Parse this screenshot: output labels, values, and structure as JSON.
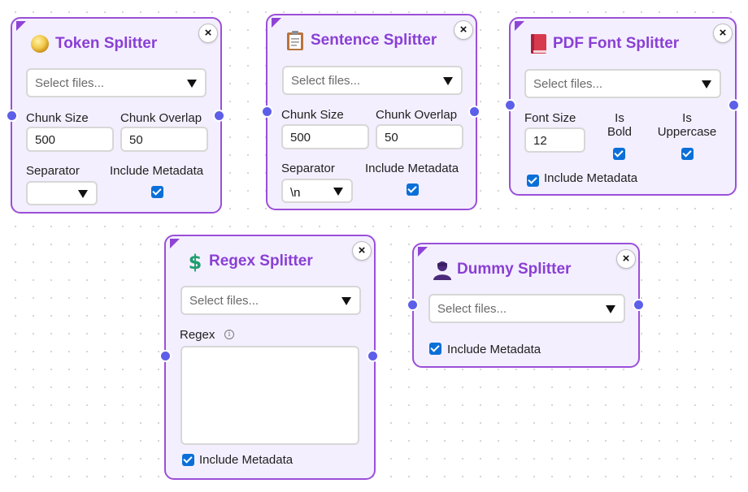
{
  "nodes": {
    "token": {
      "title": "Token Splitter",
      "icon": "coin-icon",
      "file_select_placeholder": "Select files...",
      "chunk_size_label": "Chunk Size",
      "chunk_size_value": "500",
      "chunk_overlap_label": "Chunk Overlap",
      "chunk_overlap_value": "50",
      "separator_label": "Separator",
      "separator_value": "",
      "include_metadata_label": "Include Metadata",
      "include_metadata_checked": true
    },
    "sentence": {
      "title": "Sentence Splitter",
      "icon": "clipboard-icon",
      "file_select_placeholder": "Select files...",
      "chunk_size_label": "Chunk Size",
      "chunk_size_value": "500",
      "chunk_overlap_label": "Chunk Overlap",
      "chunk_overlap_value": "50",
      "separator_label": "Separator",
      "separator_value": "\\n",
      "include_metadata_label": "Include Metadata",
      "include_metadata_checked": true
    },
    "pdf_font": {
      "title": "PDF Font Splitter",
      "icon": "red-book-icon",
      "file_select_placeholder": "Select files...",
      "font_size_label": "Font Size",
      "font_size_value": "12",
      "is_bold_label_line1": "Is",
      "is_bold_label_line2": "Bold",
      "is_bold_checked": true,
      "is_uppercase_label_line1": "Is",
      "is_uppercase_label_line2": "Uppercase",
      "is_uppercase_checked": true,
      "include_metadata_label": "Include Metadata",
      "include_metadata_checked": true
    },
    "regex": {
      "title": "Regex Splitter",
      "icon": "dollar-sign-icon",
      "file_select_placeholder": "Select files...",
      "regex_label": "Regex",
      "regex_value": "",
      "include_metadata_label": "Include Metadata",
      "include_metadata_checked": true
    },
    "dummy": {
      "title": "Dummy Splitter",
      "icon": "person-silhouette-icon",
      "file_select_placeholder": "Select files...",
      "include_metadata_label": "Include Metadata",
      "include_metadata_checked": true
    }
  },
  "close_glyph": "×",
  "info_glyph": "i",
  "colors": {
    "node_border": "#9b4fd8",
    "node_bg": "#f3efff",
    "title": "#8a3fd4",
    "port": "#5d5fe8",
    "checkbox": "#0b6fd8"
  }
}
